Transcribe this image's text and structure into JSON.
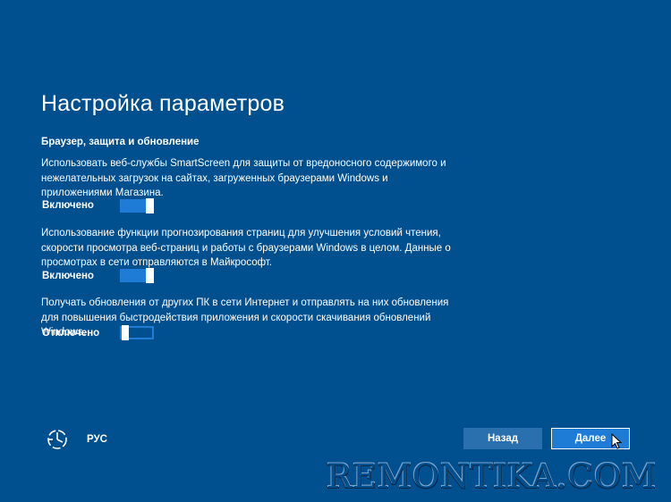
{
  "page": {
    "title": "Настройка параметров"
  },
  "section": {
    "title": "Браузер, защита и обновление"
  },
  "settings": [
    {
      "description": "Использовать веб-службы SmartScreen для защиты от вредоносного содержимого и нежелательных загрузок на сайтах, загруженных браузерами Windows и приложениями Магазина.",
      "state_label": "Включено",
      "enabled": true
    },
    {
      "description": "Использование функции прогнозирования страниц для улучшения условий чтения, скорости просмотра веб-страниц и работы с браузерами Windows в целом. Данные о просмотрах в сети отправляются в Майкрософт.",
      "state_label": "Включено",
      "enabled": true
    },
    {
      "description": "Получать обновления от других ПК в сети Интернет и отправлять на них обновления для повышения быстродействия приложения и скорости скачивания обновлений Windows.",
      "state_label": "Отключено",
      "enabled": false
    }
  ],
  "footer": {
    "accessibility_icon": "ease-of-access-icon",
    "language": "РУС",
    "back_label": "Назад",
    "next_label": "Далее"
  },
  "watermark": "REMONTIKA.COM",
  "colors": {
    "background": "#004f8f",
    "toggle_on": "#1e7bd6",
    "button": "#1e7bd6"
  }
}
